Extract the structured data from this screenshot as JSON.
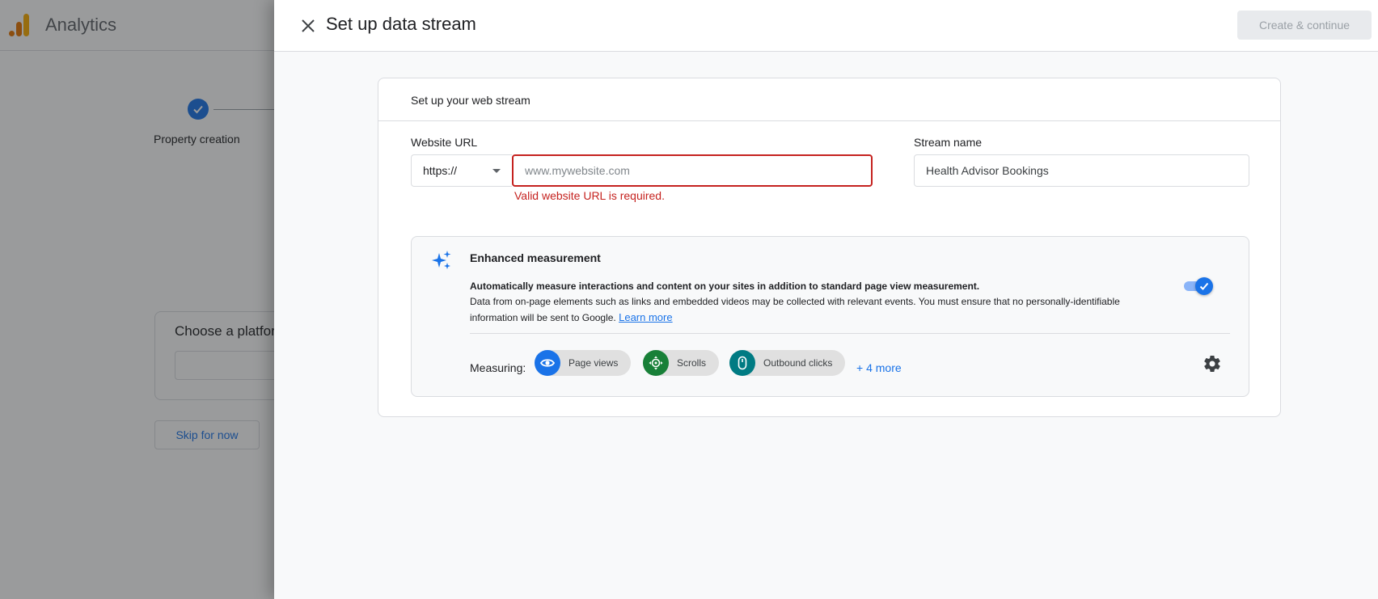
{
  "background": {
    "app_title": "Analytics",
    "step_label": "Property creation",
    "platform_title": "Choose a platform",
    "skip_label": "Skip for now"
  },
  "drawer": {
    "title": "Set up data stream",
    "create_label": "Create & continue"
  },
  "card": {
    "title": "Set up your web stream",
    "url_label": "Website URL",
    "protocol_value": "https://",
    "url_placeholder": "www.mywebsite.com",
    "url_value": "",
    "url_error": "Valid website URL is required.",
    "stream_label": "Stream name",
    "stream_value": "Health Advisor Bookings"
  },
  "enhanced": {
    "title": "Enhanced measurement",
    "desc_bold": "Automatically measure interactions and content on your sites in addition to standard page view measurement.",
    "desc_text": "Data from on-page elements such as links and embedded videos may be collected with relevant events. You must ensure that no personally-identifiable information will be sent to Google.",
    "learn_more": "Learn more",
    "toggle_on": true,
    "measuring_label": "Measuring:",
    "chips": [
      {
        "label": "Page views",
        "icon": "eye-icon",
        "color": "#1a73e8"
      },
      {
        "label": "Scrolls",
        "icon": "scroll-target-icon",
        "color": "#188038"
      },
      {
        "label": "Outbound clicks",
        "icon": "mouse-icon",
        "color": "#007b83"
      }
    ],
    "more_link": "+ 4 more"
  },
  "colors": {
    "accent": "#1a73e8",
    "error": "#c5221f",
    "analytics_orange": "#f9ab00",
    "analytics_dark_orange": "#e37400"
  }
}
